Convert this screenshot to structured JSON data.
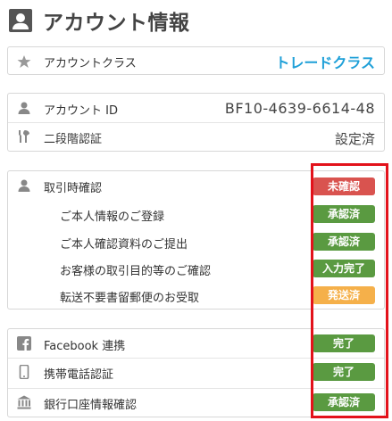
{
  "page": {
    "title": "アカウント情報"
  },
  "account_class": {
    "label": "アカウントクラス",
    "value": "トレードクラス"
  },
  "account_id": {
    "label": "アカウント ID",
    "value": "BF10-4639-6614-48"
  },
  "two_factor": {
    "label": "二段階認証",
    "value": "設定済"
  },
  "verification": {
    "label": "取引時確認",
    "status": "未確認",
    "items": [
      {
        "label": "ご本人情報のご登録",
        "status": "承認済"
      },
      {
        "label": "ご本人確認資料のご提出",
        "status": "承認済"
      },
      {
        "label": "お客様の取引目的等のご確認",
        "status": "入力完了"
      },
      {
        "label": "転送不要書留郵便のお受取",
        "status": "発送済"
      }
    ]
  },
  "integrations": [
    {
      "label": "Facebook 連携",
      "status": "完了"
    },
    {
      "label": "携帯電話認証",
      "status": "完了"
    },
    {
      "label": "銀行口座情報確認",
      "status": "承認済"
    }
  ],
  "colors": {
    "accent": "#1fa0d8",
    "status_red": "#d9534f",
    "status_green": "#5a9a41",
    "status_orange": "#f5b04a",
    "highlight": "#e3121b"
  },
  "icons": [
    "user-icon",
    "star-icon",
    "user-icon",
    "tools-icon",
    "user-icon",
    "facebook-icon",
    "mobile-icon",
    "bank-icon"
  ]
}
